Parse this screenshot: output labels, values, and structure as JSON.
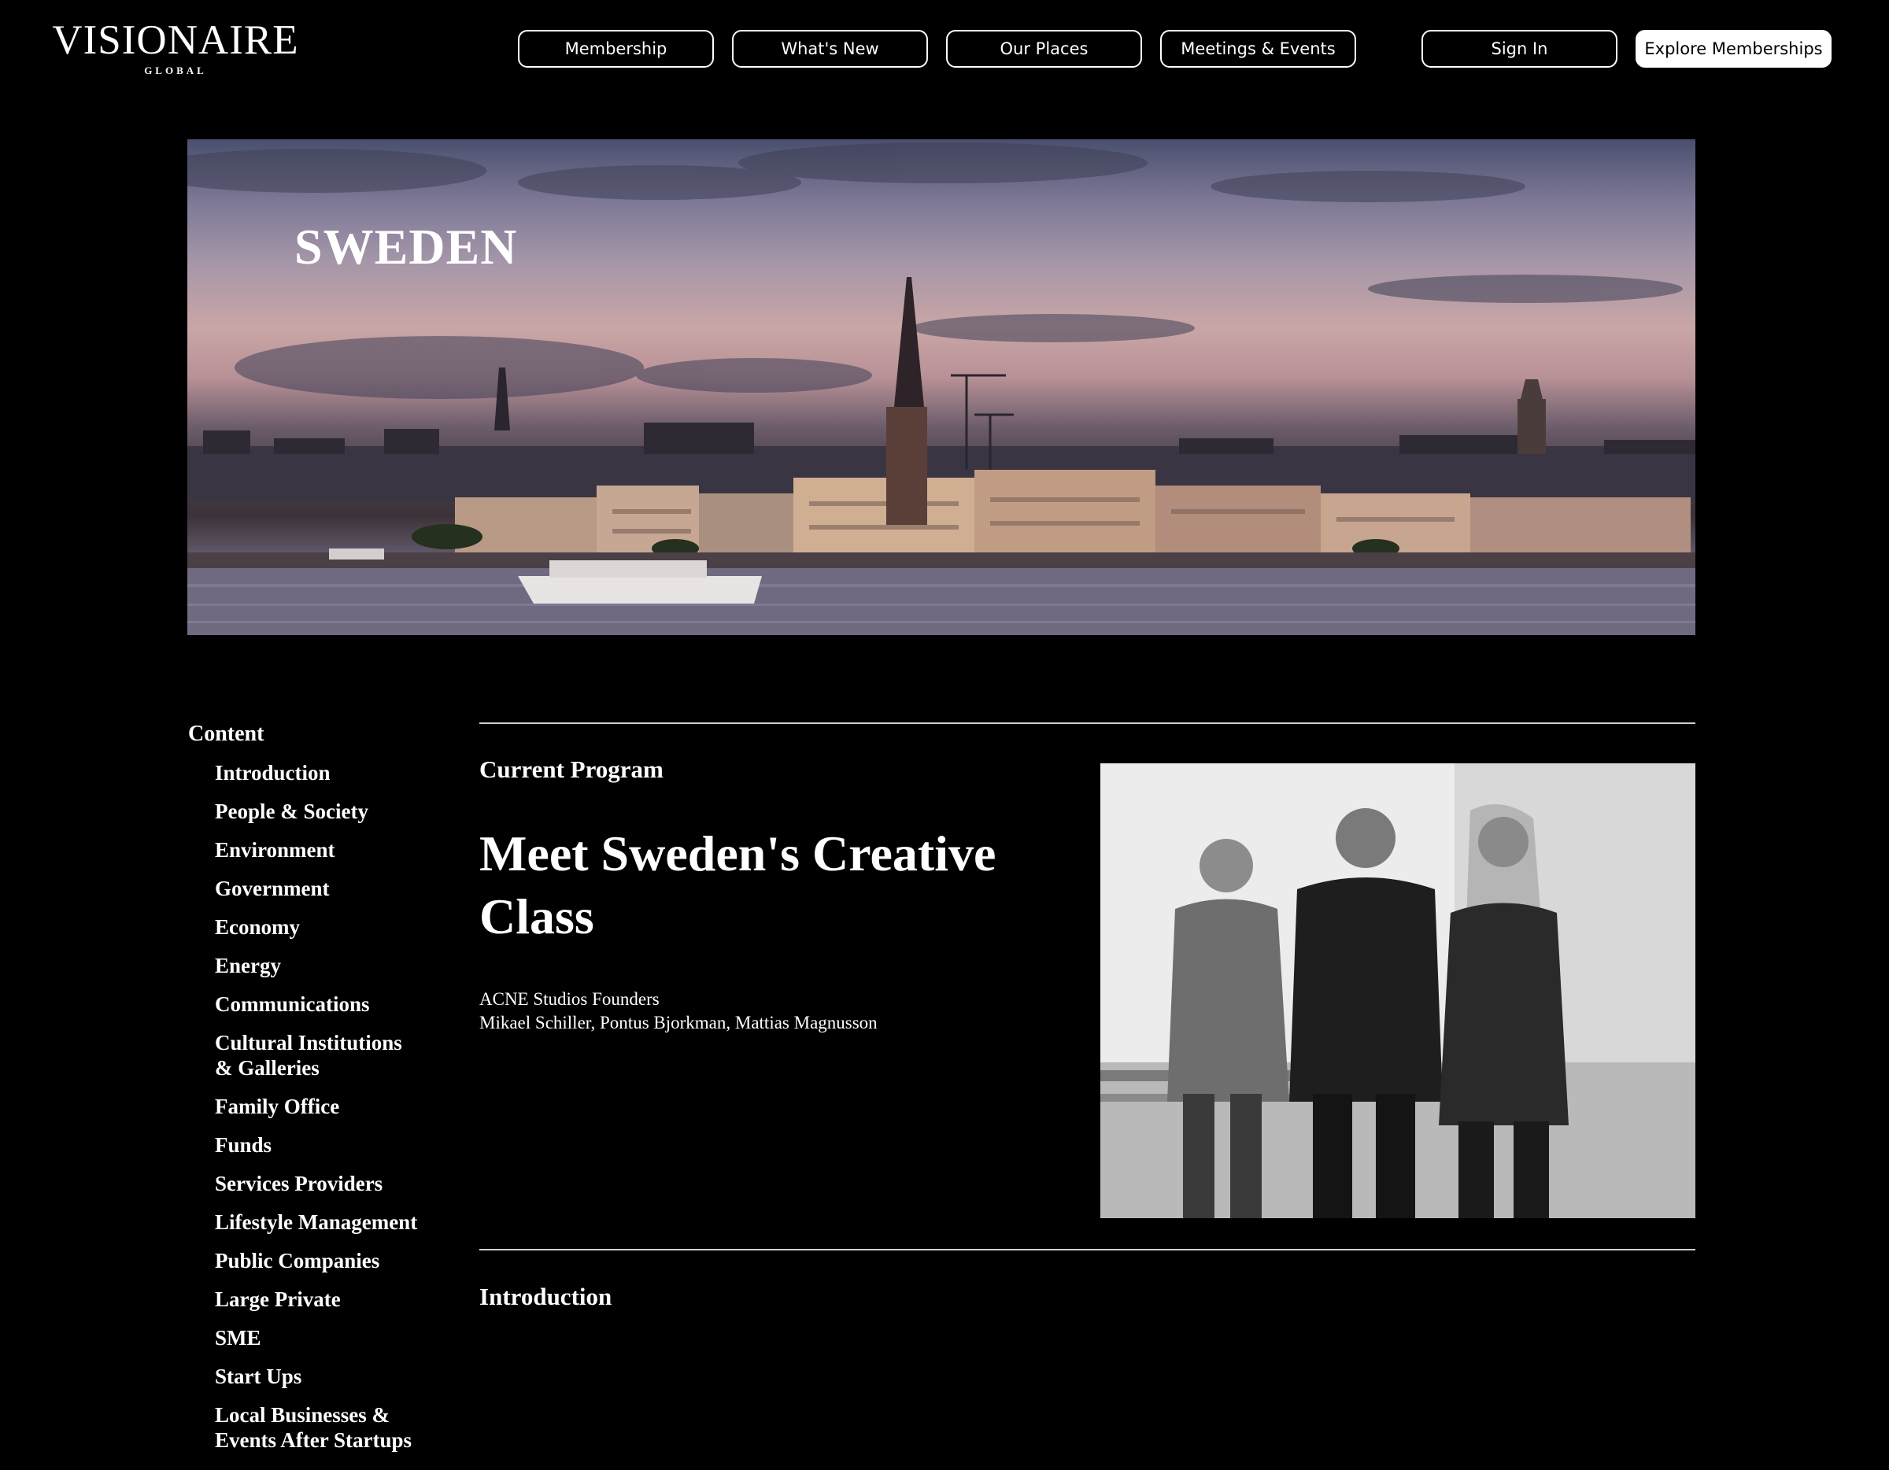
{
  "header": {
    "logo_main": "VISIONAIRE",
    "logo_sub": "GLOBAL",
    "nav": [
      {
        "label": "Membership"
      },
      {
        "label": "What's New"
      },
      {
        "label": "Our Places"
      },
      {
        "label": "Meetings & Events"
      }
    ],
    "sign_in": "Sign In",
    "explore": "Explore Memberships"
  },
  "hero": {
    "title": "SWEDEN"
  },
  "sidebar": {
    "heading": "Content",
    "items": [
      {
        "label": "Introduction"
      },
      {
        "label": "People & Society"
      },
      {
        "label": "Environment"
      },
      {
        "label": "Government"
      },
      {
        "label": "Economy"
      },
      {
        "label": "Energy"
      },
      {
        "label": "Communications"
      },
      {
        "label": "Cultural Institutions\n& Galleries"
      },
      {
        "label": "Family Office"
      },
      {
        "label": "Funds"
      },
      {
        "label": "Services  Providers"
      },
      {
        "label": "Lifestyle Management"
      },
      {
        "label": "Public Companies"
      },
      {
        "label": "Large Private"
      },
      {
        "label": "SME"
      },
      {
        "label": "Start Ups"
      },
      {
        "label": "Local Businesses &\nEvents After Startups"
      }
    ]
  },
  "main": {
    "current_program_label": "Current Program",
    "program_title": "Meet Sweden's Creative Class",
    "caption_line1": "ACNE Studios Founders",
    "caption_line2": " Mikael Schiller, Pontus Bjorkman, Mattias Magnusson",
    "introduction_label": "Introduction"
  }
}
